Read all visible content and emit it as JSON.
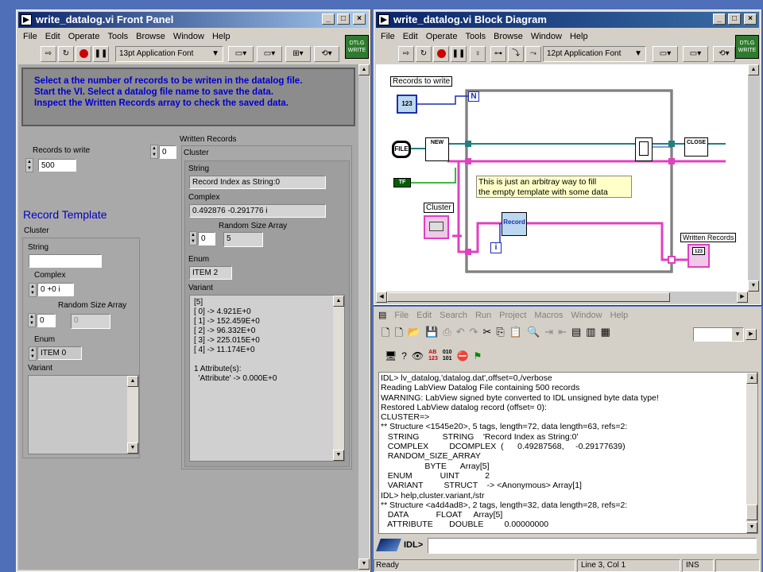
{
  "front_panel": {
    "title": "write_datalog.vi Front Panel",
    "menu": [
      "File",
      "Edit",
      "Operate",
      "Tools",
      "Browse",
      "Window",
      "Help"
    ],
    "font_select": "13pt Application Font",
    "badge": "DTLG\nWRITE",
    "instructions": [
      "Select a the number of records to be writen in the datalog file.",
      "Start the VI. Select a datalog file name to save the data.",
      "Inspect the Written Records array to check the saved data."
    ],
    "records_label": "Records to write",
    "records_value": "500",
    "record_template_title": "Record Template",
    "tmpl": {
      "cluster": "Cluster",
      "string": "String",
      "string_value": "",
      "complex": "Complex",
      "complex_value": "0 +0 i",
      "random_size": "Random Size Array",
      "index_value": "0",
      "array_value": "0",
      "enum": "Enum",
      "enum_value": "ITEM 0",
      "variant": "Variant"
    },
    "written": {
      "label": "Written Records",
      "index_value": "0",
      "cluster": "Cluster",
      "string": "String",
      "string_value": "Record Index as String:0",
      "complex": "Complex",
      "complex_value": "0.492876 -0.291776 i",
      "random_size": "Random Size Array",
      "index2": "0",
      "array_value": "5",
      "enum": "Enum",
      "enum_value": "ITEM 2",
      "variant": "Variant",
      "variant_lines": [
        "[5]",
        "[ 0] -> 4.921E+0",
        "[ 1] -> 152.459E+0",
        "[ 2] -> 96.332E+0",
        "[ 3] -> 225.015E+0",
        "[ 4] -> 11.174E+0",
        "",
        "1 Attribute(s):",
        "  'Attribute' -> 0.000E+0"
      ]
    }
  },
  "block_diagram": {
    "title": "write_datalog.vi Block Diagram",
    "menu": [
      "File",
      "Edit",
      "Operate",
      "Tools",
      "Browse",
      "Window",
      "Help"
    ],
    "font_select": "12pt Application Font",
    "badge": "DTLG\nWRITE",
    "records_label": "Records to write",
    "n_label": "N",
    "file_label": "FILE",
    "new_label": "NEW",
    "close_label": "CLOSE",
    "tf_label": "TF",
    "cluster_label": "Cluster",
    "record_label": "Record",
    "i_label": "i",
    "comment": [
      "This is just an arbitray way to fill",
      "the empty template with some data"
    ],
    "written_label": "Written Records",
    "num_label": "123"
  },
  "idl": {
    "menu": [
      "File",
      "Edit",
      "Search",
      "Run",
      "Project",
      "Macros",
      "Window",
      "Help"
    ],
    "output": [
      "IDL> lv_datalog,'datalog.dat',offset=0,/verbose",
      "Reading LabView Datalog File containing 500 records",
      "WARNING: LabView signed byte converted to IDL unsigned byte data type!",
      "Restored LabView datalog record (offset= 0):",
      "CLUSTER=>",
      "** Structure <1545e20>, 5 tags, length=72, data length=63, refs=2:",
      "   STRING          STRING    'Record Index as String:0'",
      "   COMPLEX         DCOMPLEX  (      0.49287568,     -0.29177639)",
      "   RANDOM_SIZE_ARRAY",
      "                   BYTE      Array[5]",
      "   ENUM            UINT           2",
      "   VARIANT         STRUCT    -> <Anonymous> Array[1]",
      "IDL> help,cluster.variant,/str",
      "** Structure <a4d4ad8>, 2 tags, length=32, data length=28, refs=2:",
      "   DATA            FLOAT     Array[5]",
      "   ATTRIBUTE       DOUBLE         0.00000000"
    ],
    "prompt": "IDL>",
    "status": "Ready",
    "position": "Line 3, Col 1",
    "mode": "INS",
    "ab_icon": "AB\n123",
    "bin_icon": "010\n101"
  }
}
